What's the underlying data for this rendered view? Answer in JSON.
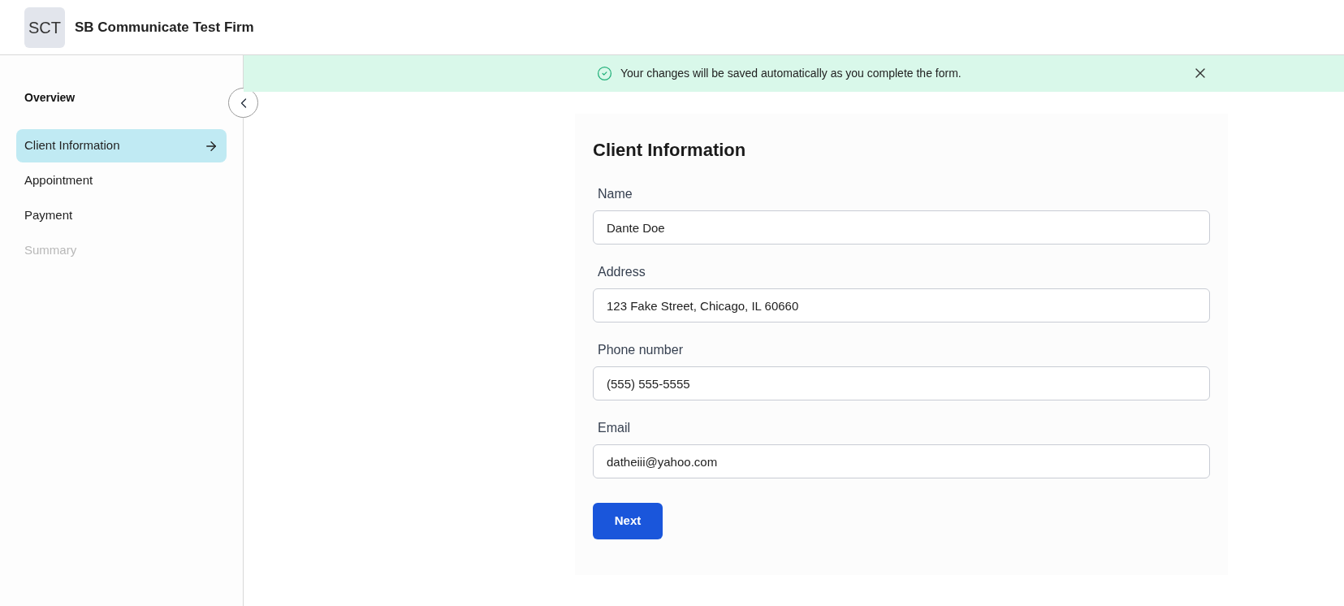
{
  "header": {
    "logo": "SCT",
    "firm_name": "SB Communicate Test Firm"
  },
  "sidebar": {
    "heading": "Overview",
    "items": [
      {
        "label": "Client Information",
        "selected": true,
        "disabled": false
      },
      {
        "label": "Appointment",
        "selected": false,
        "disabled": false
      },
      {
        "label": "Payment",
        "selected": false,
        "disabled": false
      },
      {
        "label": "Summary",
        "selected": false,
        "disabled": true
      }
    ]
  },
  "banner": {
    "message": "Your changes will be saved automatically as you complete the form."
  },
  "form": {
    "title": "Client Information",
    "fields": [
      {
        "label": "Name",
        "value": "Dante Doe"
      },
      {
        "label": "Address",
        "value": "123 Fake Street, Chicago, IL 60660"
      },
      {
        "label": "Phone number",
        "value": "(555) 555-5555"
      },
      {
        "label": "Email",
        "value": "datheiii@yahoo.com"
      }
    ],
    "button": "Next"
  }
}
